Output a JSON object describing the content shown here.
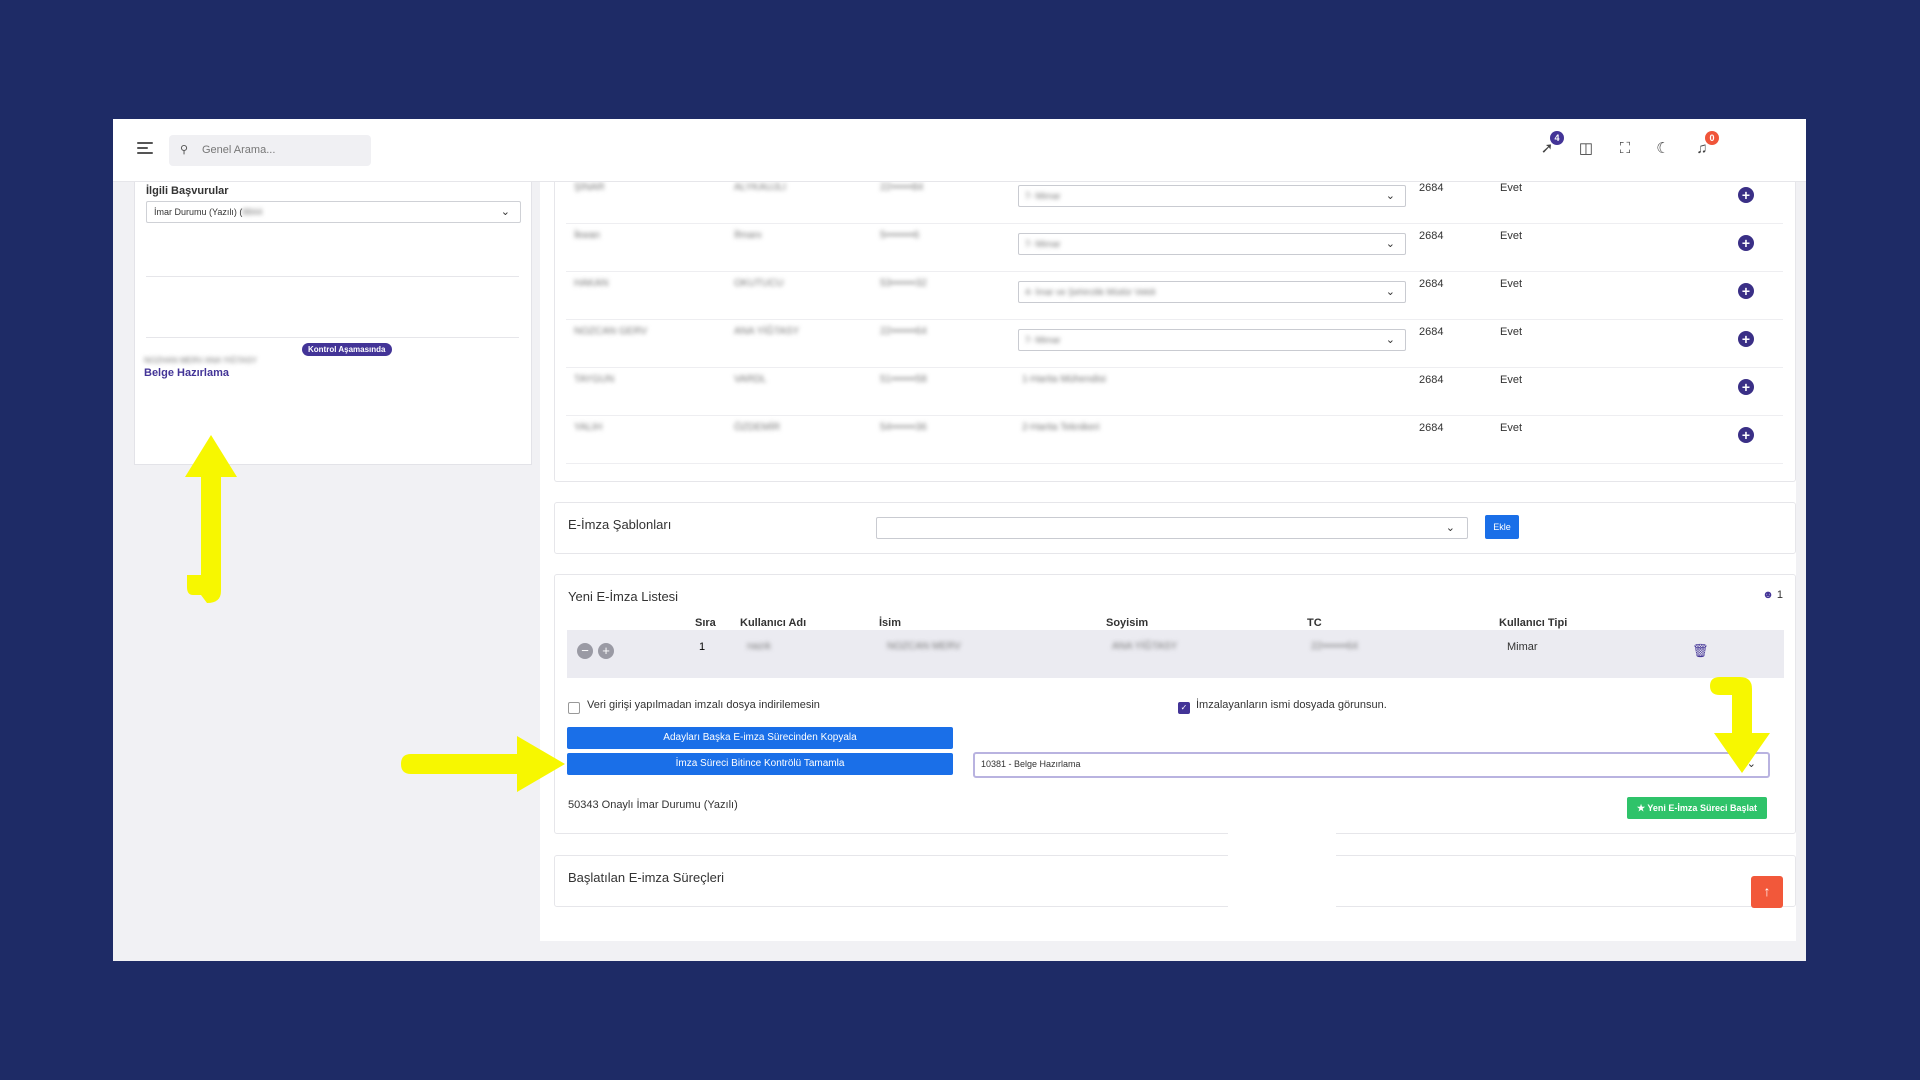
{
  "topbar": {
    "search_placeholder": "Genel Arama...",
    "icons": [
      {
        "name": "rocket-icon",
        "badge": "4",
        "badge_color": "#433497"
      },
      {
        "name": "sidebar-icon",
        "badge": ""
      },
      {
        "name": "fullscreen-icon",
        "badge": ""
      },
      {
        "name": "moon-icon",
        "badge": ""
      },
      {
        "name": "bell-icon",
        "badge": "0",
        "badge_color": "#f0553a"
      }
    ]
  },
  "left": {
    "title": "İlgili Başvurular",
    "select_value": "İmar Durumu (Yazılı) (",
    "select_value_hidden": "8844",
    "status_pill": "Kontrol Aşamasında",
    "owner_hidden": "NOZHAN MERV ANA YIĞTASY",
    "link": "Belge Hazırlama"
  },
  "users_table": {
    "rows": [
      {
        "name": "ŞİNAR",
        "surname": "ALYKAUJLI",
        "tc": "22••••••84",
        "type": "7- Mimar",
        "code": "2684",
        "yes": "Evet",
        "has_dropdown": true
      },
      {
        "name": "İkwan",
        "surname": "İfmanı",
        "tc": "5••••••••6",
        "type": "7- Mimar",
        "code": "2684",
        "yes": "Evet",
        "has_dropdown": true
      },
      {
        "name": "HAKAN",
        "surname": "OKUTUCU",
        "tc": "53•••••••32",
        "type": "4- İmar ve Şehircilik Müdür Vekili",
        "code": "2684",
        "yes": "Evet",
        "has_dropdown": true
      },
      {
        "name": "NOZCAN GERV",
        "surname": "ANA YİĞTASY",
        "tc": "22•••••••64",
        "type": "7- Mimar",
        "code": "2684",
        "yes": "Evet",
        "has_dropdown": true
      },
      {
        "name": "TAYGUN",
        "surname": "VARDL",
        "tc": "51•••••••58",
        "type": "1-Harita Mühendisi",
        "code": "2684",
        "yes": "Evet",
        "has_dropdown": false
      },
      {
        "name": "YALIH",
        "surname": "ÖZDEMİR",
        "tc": "54•••••••36",
        "type": "2-Harita Teknikeri",
        "code": "2684",
        "yes": "Evet",
        "has_dropdown": false
      }
    ]
  },
  "templates": {
    "title": "E-İmza Şablonları",
    "add_button": "Ekle"
  },
  "new_list": {
    "title": "Yeni E-İmza Listesi",
    "count": "1",
    "headers": [
      "Sıra",
      "Kullanıcı Adı",
      "İsim",
      "Soyisim",
      "TC",
      "Kullanıcı Tipi"
    ],
    "row": {
      "order": "1",
      "username": "nazık",
      "name": "NOZCAN MERV",
      "surname": "ANA YİĞTASY",
      "tc": "22•••••••64",
      "type": "Mimar"
    },
    "chk_download": "Veri girişi yapılmadan imzalı dosya indirilemesin",
    "chk_download_checked": false,
    "chk_show_names": "İmzalayanların ismi dosyada görunsun.",
    "chk_show_names_checked": true,
    "copy_button": "Adayları Başka E-imza Sürecinden Kopyala",
    "complete_button": "İmza Süreci Bitince Kontrölü Tamamla",
    "process_select": "10381 - Belge Hazırlama",
    "document_label": "50343 Onaylı İmar Durumu (Yazılı)",
    "start_button": "★ Yeni E-İmza Süreci Başlat"
  },
  "started": {
    "title": "Başlatılan E-imza Süreçleri"
  },
  "colors": {
    "primary": "#1a6fe8",
    "brand": "#433497",
    "success": "#2fc36a",
    "annotation": "#f7f700",
    "scroll_top": "#f2583a"
  }
}
